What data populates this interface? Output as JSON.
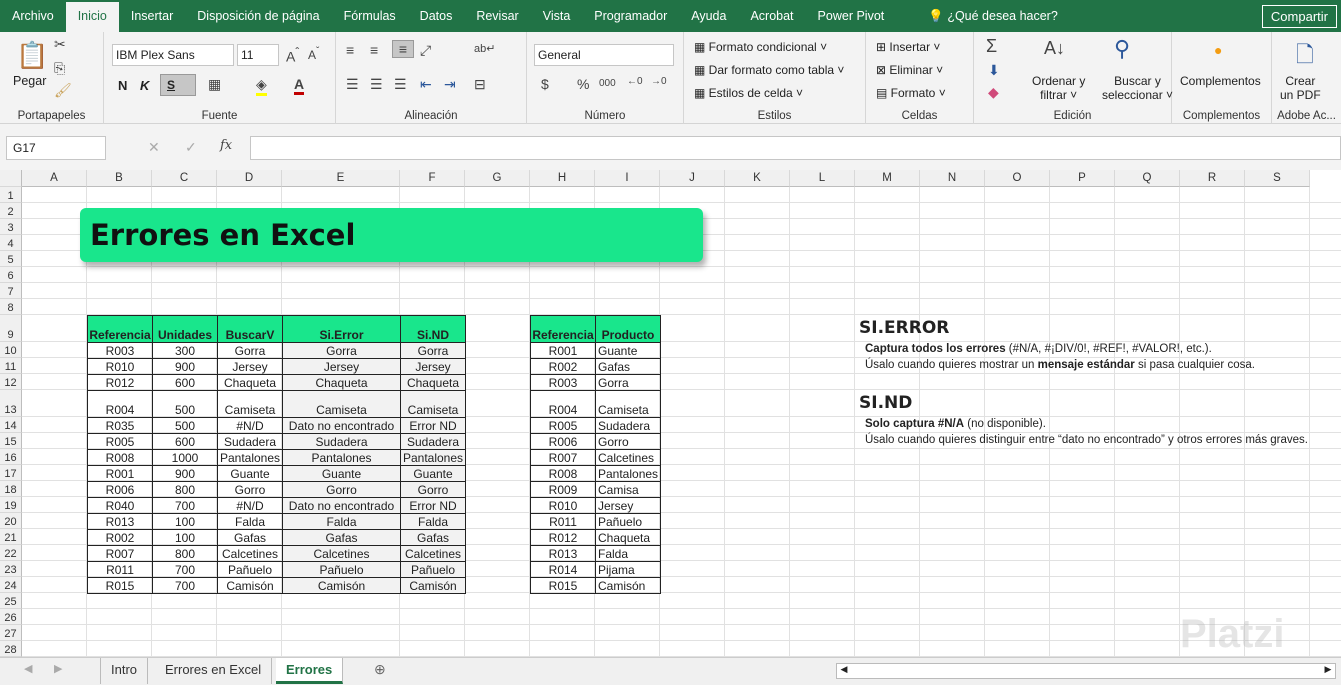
{
  "menu": {
    "tabs": [
      "Archivo",
      "Inicio",
      "Insertar",
      "Disposición de página",
      "Fórmulas",
      "Datos",
      "Revisar",
      "Vista",
      "Programador",
      "Ayuda",
      "Acrobat",
      "Power Pivot"
    ],
    "tell_me": "¿Qué desea hacer?",
    "share": "Compartir"
  },
  "ribbon": {
    "clipboard": {
      "paste": "Pegar",
      "label": "Portapapeles"
    },
    "font": {
      "name": "IBM Plex Sans",
      "size": "11",
      "bold": "N",
      "italic": "K",
      "underline": "S",
      "label": "Fuente"
    },
    "alignment": {
      "label": "Alineación"
    },
    "number": {
      "format": "General",
      "label": "Número"
    },
    "styles": {
      "conditional": "Formato condicional",
      "table": "Dar formato como tabla",
      "cell": "Estilos de celda",
      "label": "Estilos"
    },
    "cells": {
      "insert": "Insertar",
      "delete": "Eliminar",
      "format": "Formato",
      "label": "Celdas"
    },
    "editing": {
      "sort1": "Ordenar y",
      "sort2": "filtrar",
      "find1": "Buscar y",
      "find2": "seleccionar",
      "label": "Edición"
    },
    "addins": {
      "btn": "Complementos",
      "label": "Complementos"
    },
    "adobe": {
      "btn1": "Crear",
      "btn2": "un PDF",
      "label": "Adobe Ac..."
    }
  },
  "formula_bar": {
    "name_box": "G17",
    "fx": "fx",
    "value": ""
  },
  "columns": [
    "A",
    "B",
    "C",
    "D",
    "E",
    "F",
    "G",
    "H",
    "I",
    "J",
    "K",
    "L",
    "M",
    "N",
    "O",
    "P",
    "Q",
    "R",
    "S"
  ],
  "banner": "Errores en Excel",
  "table1": {
    "headers": [
      "Referencia",
      "Unidades",
      "BuscarV",
      "Si.Error",
      "Si.ND"
    ],
    "rows": [
      [
        "R003",
        "300",
        "Gorra",
        "Gorra",
        "Gorra"
      ],
      [
        "R010",
        "900",
        "Jersey",
        "Jersey",
        "Jersey"
      ],
      [
        "R012",
        "600",
        "Chaqueta",
        "Chaqueta",
        "Chaqueta"
      ],
      [
        "R004",
        "500",
        "Camiseta",
        "Camiseta",
        "Camiseta"
      ],
      [
        "R035",
        "500",
        "#N/D",
        "Dato no encontrado",
        "Error ND"
      ],
      [
        "R005",
        "600",
        "Sudadera",
        "Sudadera",
        "Sudadera"
      ],
      [
        "R008",
        "1000",
        "Pantalones",
        "Pantalones",
        "Pantalones"
      ],
      [
        "R001",
        "900",
        "Guante",
        "Guante",
        "Guante"
      ],
      [
        "R006",
        "800",
        "Gorro",
        "Gorro",
        "Gorro"
      ],
      [
        "R040",
        "700",
        "#N/D",
        "Dato no encontrado",
        "Error ND"
      ],
      [
        "R013",
        "100",
        "Falda",
        "Falda",
        "Falda"
      ],
      [
        "R002",
        "100",
        "Gafas",
        "Gafas",
        "Gafas"
      ],
      [
        "R007",
        "800",
        "Calcetines",
        "Calcetines",
        "Calcetines"
      ],
      [
        "R011",
        "700",
        "Pañuelo",
        "Pañuelo",
        "Pañuelo"
      ],
      [
        "R015",
        "700",
        "Camisón",
        "Camisón",
        "Camisón"
      ]
    ]
  },
  "table2": {
    "headers": [
      "Referencia",
      "Producto"
    ],
    "rows": [
      [
        "R001",
        "Guante"
      ],
      [
        "R002",
        "Gafas"
      ],
      [
        "R003",
        "Gorra"
      ],
      [
        "R004",
        "Camiseta"
      ],
      [
        "R005",
        "Sudadera"
      ],
      [
        "R006",
        "Gorro"
      ],
      [
        "R007",
        "Calcetines"
      ],
      [
        "R008",
        "Pantalones"
      ],
      [
        "R009",
        "Camisa"
      ],
      [
        "R010",
        "Jersey"
      ],
      [
        "R011",
        "Pañuelo"
      ],
      [
        "R012",
        "Chaqueta"
      ],
      [
        "R013",
        "Falda"
      ],
      [
        "R014",
        "Pijama"
      ],
      [
        "R015",
        "Camisón"
      ]
    ]
  },
  "notes": {
    "si_error": {
      "title": "SI.ERROR",
      "l1_bold": "Captura todos los errores",
      "l1_rest": " (#N/A, #¡DIV/0!, #REF!, #VALOR!, etc.).",
      "l2_a": "Úsalo cuando quieres mostrar un ",
      "l2_bold": "mensaje estándar",
      "l2_b": " si pasa cualquier cosa."
    },
    "si_nd": {
      "title": "SI.ND",
      "l1_bold": "Solo captura #N/A",
      "l1_rest": " (no disponible).",
      "l2": "Úsalo cuando quieres distinguir entre “dato no encontrado” y otros errores más graves."
    }
  },
  "sheets": [
    "Intro",
    "Errores en Excel",
    "Errores"
  ],
  "watermark": "Platzi"
}
